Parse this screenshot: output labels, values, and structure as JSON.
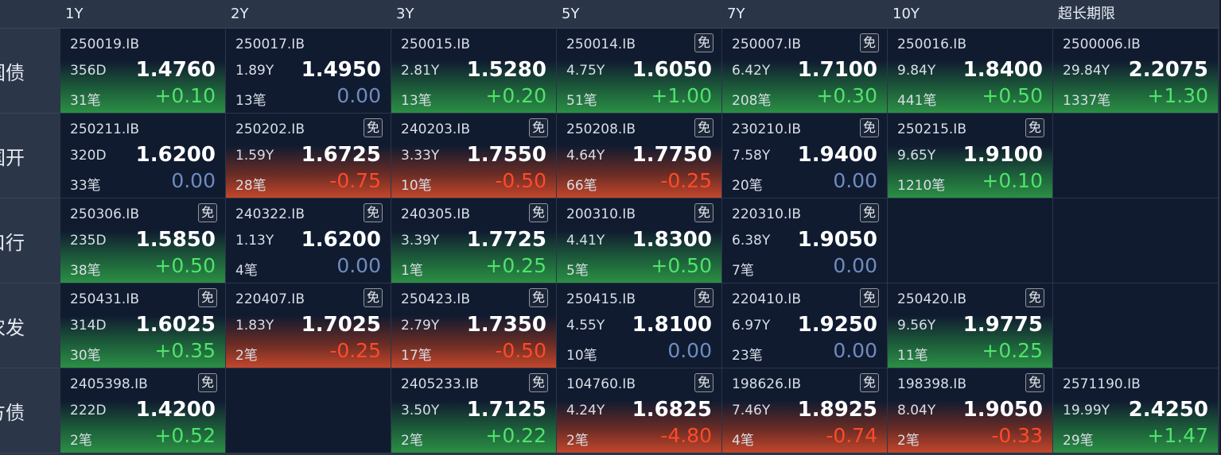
{
  "headers": [
    "",
    "1Y",
    "2Y",
    "3Y",
    "5Y",
    "7Y",
    "10Y",
    "超长期限"
  ],
  "mian_label": "免",
  "rows": [
    {
      "label": "国债",
      "cells": [
        {
          "code": "250019.IB",
          "mian": false,
          "term": "356D",
          "yield": "1.4760",
          "deals": "31笔",
          "change": "+0.10",
          "trend": "up"
        },
        {
          "code": "250017.IB",
          "mian": false,
          "term": "1.89Y",
          "yield": "1.4950",
          "deals": "13笔",
          "change": "0.00",
          "trend": "flat"
        },
        {
          "code": "250015.IB",
          "mian": false,
          "term": "2.81Y",
          "yield": "1.5280",
          "deals": "13笔",
          "change": "+0.20",
          "trend": "up"
        },
        {
          "code": "250014.IB",
          "mian": true,
          "term": "4.75Y",
          "yield": "1.6050",
          "deals": "51笔",
          "change": "+1.00",
          "trend": "up"
        },
        {
          "code": "250007.IB",
          "mian": true,
          "term": "6.42Y",
          "yield": "1.7100",
          "deals": "208笔",
          "change": "+0.30",
          "trend": "up"
        },
        {
          "code": "250016.IB",
          "mian": false,
          "term": "9.84Y",
          "yield": "1.8400",
          "deals": "441笔",
          "change": "+0.50",
          "trend": "up"
        },
        {
          "code": "2500006.IB",
          "mian": false,
          "term": "29.84Y",
          "yield": "2.2075",
          "deals": "1337笔",
          "change": "+1.30",
          "trend": "up"
        }
      ]
    },
    {
      "label": "国开",
      "cells": [
        {
          "code": "250211.IB",
          "mian": false,
          "term": "320D",
          "yield": "1.6200",
          "deals": "33笔",
          "change": "0.00",
          "trend": "flat"
        },
        {
          "code": "250202.IB",
          "mian": true,
          "term": "1.59Y",
          "yield": "1.6725",
          "deals": "28笔",
          "change": "-0.75",
          "trend": "down"
        },
        {
          "code": "240203.IB",
          "mian": true,
          "term": "3.33Y",
          "yield": "1.7550",
          "deals": "10笔",
          "change": "-0.50",
          "trend": "down"
        },
        {
          "code": "250208.IB",
          "mian": true,
          "term": "4.64Y",
          "yield": "1.7750",
          "deals": "66笔",
          "change": "-0.25",
          "trend": "down"
        },
        {
          "code": "230210.IB",
          "mian": true,
          "term": "7.58Y",
          "yield": "1.9400",
          "deals": "20笔",
          "change": "0.00",
          "trend": "flat"
        },
        {
          "code": "250215.IB",
          "mian": true,
          "term": "9.65Y",
          "yield": "1.9100",
          "deals": "1210笔",
          "change": "+0.10",
          "trend": "up"
        },
        null
      ]
    },
    {
      "label": "口行",
      "cells": [
        {
          "code": "250306.IB",
          "mian": true,
          "term": "235D",
          "yield": "1.5850",
          "deals": "38笔",
          "change": "+0.50",
          "trend": "up"
        },
        {
          "code": "240322.IB",
          "mian": true,
          "term": "1.13Y",
          "yield": "1.6200",
          "deals": "4笔",
          "change": "0.00",
          "trend": "flat"
        },
        {
          "code": "240305.IB",
          "mian": true,
          "term": "3.39Y",
          "yield": "1.7725",
          "deals": "1笔",
          "change": "+0.25",
          "trend": "up"
        },
        {
          "code": "200310.IB",
          "mian": true,
          "term": "4.41Y",
          "yield": "1.8300",
          "deals": "5笔",
          "change": "+0.50",
          "trend": "up"
        },
        {
          "code": "220310.IB",
          "mian": true,
          "term": "6.38Y",
          "yield": "1.9050",
          "deals": "7笔",
          "change": "0.00",
          "trend": "flat"
        },
        null,
        null
      ]
    },
    {
      "label": "农发",
      "cells": [
        {
          "code": "250431.IB",
          "mian": true,
          "term": "314D",
          "yield": "1.6025",
          "deals": "30笔",
          "change": "+0.35",
          "trend": "up"
        },
        {
          "code": "220407.IB",
          "mian": true,
          "term": "1.83Y",
          "yield": "1.7025",
          "deals": "2笔",
          "change": "-0.25",
          "trend": "down"
        },
        {
          "code": "250423.IB",
          "mian": true,
          "term": "2.79Y",
          "yield": "1.7350",
          "deals": "17笔",
          "change": "-0.50",
          "trend": "down"
        },
        {
          "code": "250415.IB",
          "mian": true,
          "term": "4.55Y",
          "yield": "1.8100",
          "deals": "10笔",
          "change": "0.00",
          "trend": "flat"
        },
        {
          "code": "220410.IB",
          "mian": true,
          "term": "6.97Y",
          "yield": "1.9250",
          "deals": "23笔",
          "change": "0.00",
          "trend": "flat"
        },
        {
          "code": "250420.IB",
          "mian": true,
          "term": "9.56Y",
          "yield": "1.9775",
          "deals": "11笔",
          "change": "+0.25",
          "trend": "up"
        },
        null
      ]
    },
    {
      "label": "地方债",
      "cells": [
        {
          "code": "2405398.IB",
          "mian": true,
          "term": "222D",
          "yield": "1.4200",
          "deals": "2笔",
          "change": "+0.52",
          "trend": "up"
        },
        null,
        {
          "code": "2405233.IB",
          "mian": true,
          "term": "3.50Y",
          "yield": "1.7125",
          "deals": "2笔",
          "change": "+0.22",
          "trend": "up"
        },
        {
          "code": "104760.IB",
          "mian": true,
          "term": "4.24Y",
          "yield": "1.6825",
          "deals": "2笔",
          "change": "-4.80",
          "trend": "down"
        },
        {
          "code": "198626.IB",
          "mian": true,
          "term": "7.46Y",
          "yield": "1.8925",
          "deals": "4笔",
          "change": "-0.74",
          "trend": "down"
        },
        {
          "code": "198398.IB",
          "mian": true,
          "term": "8.04Y",
          "yield": "1.9050",
          "deals": "2笔",
          "change": "-0.33",
          "trend": "down"
        },
        {
          "code": "2571190.IB",
          "mian": false,
          "term": "19.99Y",
          "yield": "2.4250",
          "deals": "29笔",
          "change": "+1.47",
          "trend": "up"
        }
      ]
    }
  ]
}
